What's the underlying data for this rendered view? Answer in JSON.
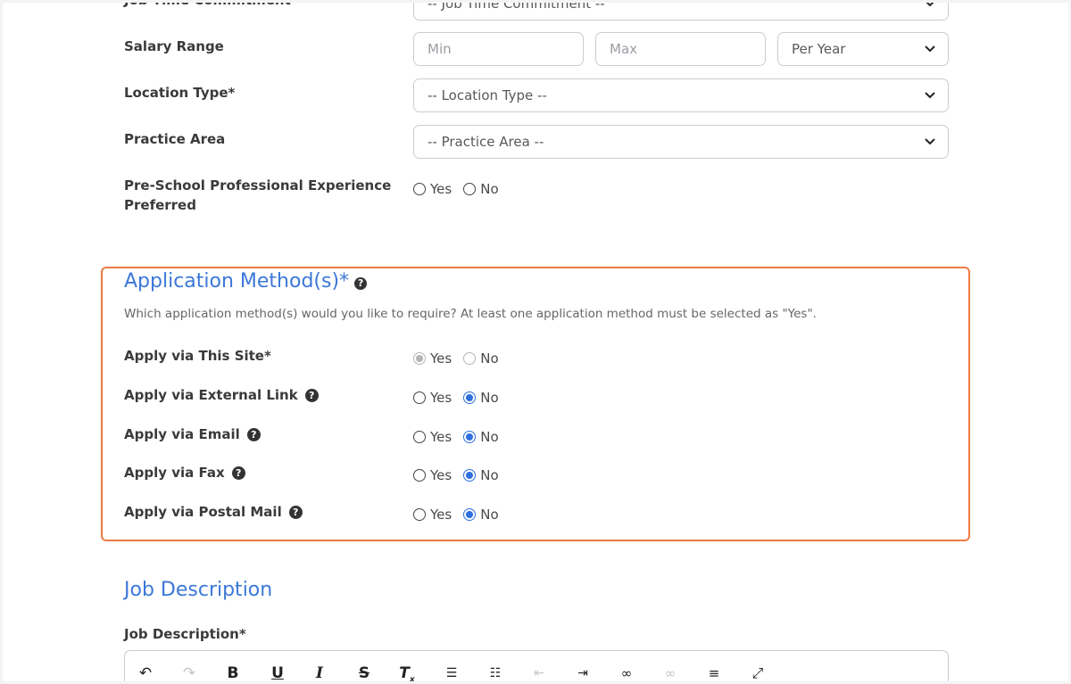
{
  "form": {
    "job_time": {
      "label": "Job Time Commitment",
      "placeholder": "-- Job Time Commitment --"
    },
    "salary": {
      "label": "Salary Range",
      "min_placeholder": "Min",
      "max_placeholder": "Max",
      "period_value": "Per Year"
    },
    "location_type": {
      "label": "Location Type*",
      "value": "-- Location Type --"
    },
    "practice_area": {
      "label": "Practice Area",
      "value": "-- Practice Area --"
    },
    "preschool_experience": {
      "label_line1": "Pre-School Professional Experience",
      "label_line2": "Preferred",
      "yes": "Yes",
      "no": "No"
    }
  },
  "application_methods": {
    "title": "Application Method(s)*",
    "description": "Which application method(s) would you like to require? At least one application method must be selected as \"Yes\".",
    "rows": [
      {
        "label": "Apply via This Site*",
        "yes": "Yes",
        "no": "No",
        "selected": "yes",
        "disabled": true,
        "help": false
      },
      {
        "label": "Apply via External Link",
        "yes": "Yes",
        "no": "No",
        "selected": "no",
        "disabled": false,
        "help": true
      },
      {
        "label": "Apply via Email",
        "yes": "Yes",
        "no": "No",
        "selected": "no",
        "disabled": false,
        "help": true
      },
      {
        "label": "Apply via Fax",
        "yes": "Yes",
        "no": "No",
        "selected": "no",
        "disabled": false,
        "help": true
      },
      {
        "label": "Apply via Postal Mail",
        "yes": "Yes",
        "no": "No",
        "selected": "no",
        "disabled": false,
        "help": true
      }
    ]
  },
  "job_description": {
    "title": "Job Description",
    "field_label": "Job Description*"
  },
  "editor_toolbar": {
    "buttons": [
      "undo-icon",
      "redo-icon",
      "bold-icon",
      "underline-icon",
      "italic-icon",
      "strikethrough-icon",
      "clear-format-icon",
      "numbered-list-icon",
      "bulleted-list-icon",
      "outdent-icon",
      "indent-icon",
      "link-icon",
      "unlink-icon",
      "horizontal-rule-icon",
      "fullscreen-icon"
    ]
  },
  "colors": {
    "accent": "#3c78d8",
    "highlight_border": "#f07a45",
    "radio_checked": "#2f6fdf"
  }
}
